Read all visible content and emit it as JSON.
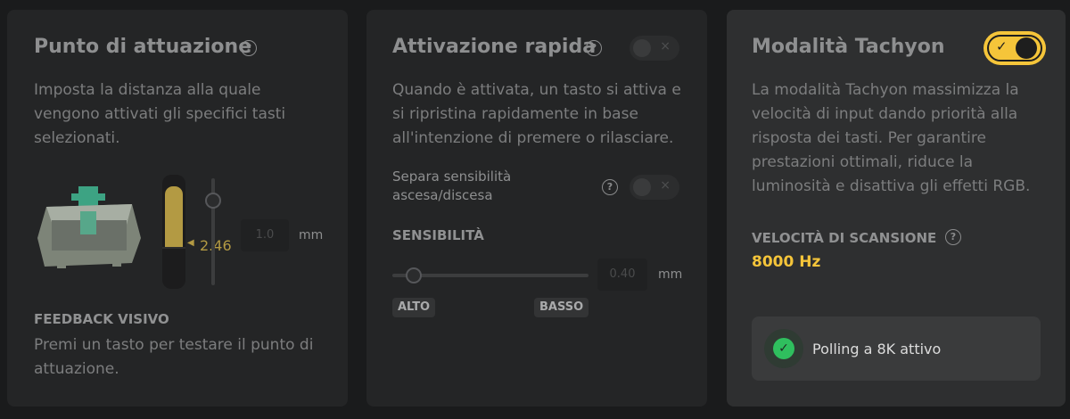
{
  "actuation": {
    "title": "Punto di attuazione",
    "description": "Imposta la distanza alla quale vengono attivati gli specifici tasti selezionati.",
    "current_value": "2.46",
    "input_value": "1.0",
    "unit": "mm",
    "feedback_title": "FEEDBACK VISIVO",
    "feedback_text": "Premi un tasto per testare il punto di attuazione."
  },
  "rapid": {
    "title": "Attivazione rapida",
    "toggle_icon": "×",
    "description": "Quando è attivata, un tasto si attiva e si ripristina rapidamente in base all'intenzione di premere o rilasciare.",
    "separate_label": "Separa sensibilità ascesa/discesa",
    "separate_toggle_icon": "×",
    "sensitivity_title": "SENSIBILITÀ",
    "sensitivity_value": "0.40",
    "unit": "mm",
    "low_label": "ALTO",
    "high_label": "BASSO"
  },
  "tachyon": {
    "title": "Modalità Tachyon",
    "toggle_check": "✓",
    "description": "La modalità Tachyon massimizza la velocità di input dando priorità alla risposta dei tasti. Per garantire prestazioni ottimali, riduce la luminosità e disattiva gli effetti RGB.",
    "scan_speed_title": "VELOCITÀ DI SCANSIONE",
    "scan_speed_value": "8000 Hz",
    "polling_check": "✓",
    "polling_text": "Polling a 8K attivo"
  },
  "help_glyph": "?",
  "colors": {
    "accent": "#f5c53a",
    "meter": "#b39a43",
    "success": "#2fbf5e"
  }
}
